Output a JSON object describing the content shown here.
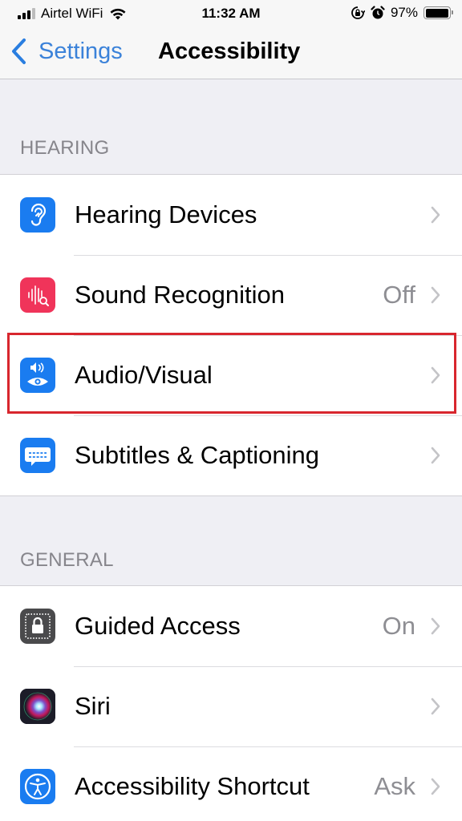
{
  "status_bar": {
    "carrier": "Airtel WiFi",
    "time": "11:32 AM",
    "battery_percent": "97%",
    "battery_level": 0.97,
    "signal_bars_active": 3,
    "signal_bars_total": 4,
    "icons": [
      "signal-icon",
      "wifi-icon",
      "orientation-lock-icon",
      "alarm-icon",
      "battery-icon"
    ]
  },
  "nav": {
    "back_label": "Settings",
    "title": "Accessibility"
  },
  "sections": [
    {
      "header": "HEARING",
      "items": [
        {
          "label": "Hearing Devices",
          "value": "",
          "icon": "ear-icon",
          "icon_color": "#1a7cf0"
        },
        {
          "label": "Sound Recognition",
          "value": "Off",
          "icon": "sound-recognition-icon",
          "icon_color": "#f0345a"
        },
        {
          "label": "Audio/Visual",
          "value": "",
          "icon": "audio-visual-icon",
          "icon_color": "#1a7cf0",
          "highlighted": true
        },
        {
          "label": "Subtitles & Captioning",
          "value": "",
          "icon": "captions-icon",
          "icon_color": "#1a7cf0"
        }
      ]
    },
    {
      "header": "GENERAL",
      "items": [
        {
          "label": "Guided Access",
          "value": "On",
          "icon": "guided-access-lock-icon",
          "icon_color": "#4a4a4c"
        },
        {
          "label": "Siri",
          "value": "",
          "icon": "siri-icon",
          "icon_color": "#1c1c28"
        },
        {
          "label": "Accessibility Shortcut",
          "value": "Ask",
          "icon": "accessibility-icon",
          "icon_color": "#1a7cf0"
        }
      ]
    }
  ],
  "colors": {
    "accent": "#3b82d9",
    "highlight_border": "#d8262e",
    "background": "#efeff4",
    "secondary_text": "#8e8e93"
  }
}
